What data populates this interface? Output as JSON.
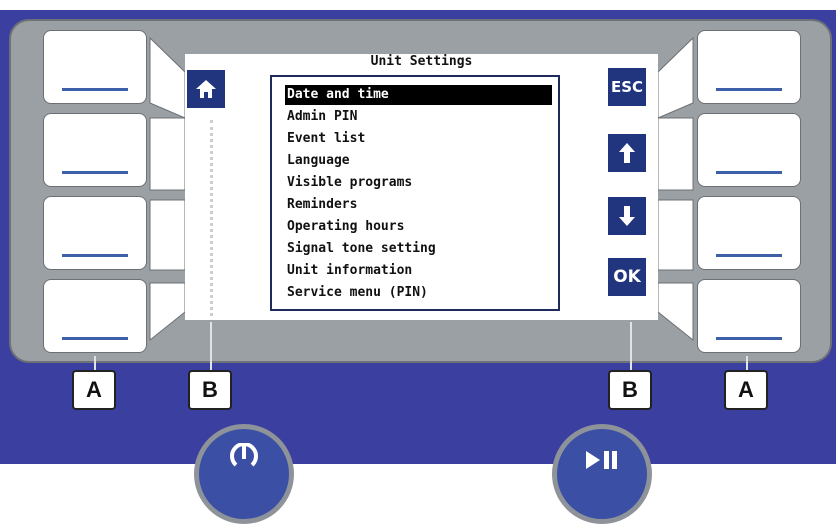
{
  "screen": {
    "title": "Unit Settings",
    "menu_items": [
      "Date and time",
      "Admin PIN",
      "Event list",
      "Language",
      "Visible programs",
      "Reminders",
      "Operating hours",
      "Signal tone setting",
      "Unit information",
      "Service menu (PIN)"
    ],
    "selected_index": 0
  },
  "buttons": {
    "home_icon": "home-icon",
    "esc_label": "ESC",
    "up_icon": "arrow-up-icon",
    "down_icon": "arrow-down-icon",
    "ok_label": "OK"
  },
  "callouts": {
    "left_a": "A",
    "left_b": "B",
    "right_b": "B",
    "right_a": "A"
  },
  "colors": {
    "panel": "#3b3fa0",
    "bezel": "#9aa0a4",
    "button": "#20357e",
    "softkey_bar": "#3d5fa8"
  }
}
